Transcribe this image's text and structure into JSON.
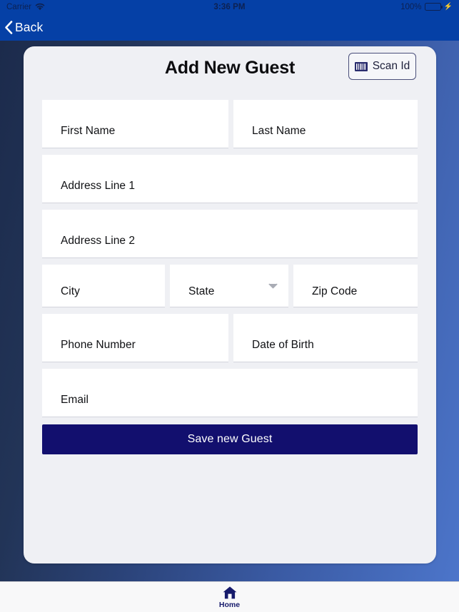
{
  "status_bar": {
    "carrier": "Carrier",
    "wifi_icon": "wifi-icon",
    "time": "3:36 PM",
    "battery_percent": "100%",
    "battery_icon": "battery-full-icon",
    "charging_icon": "lightning-bolt-icon",
    "bg_color": "#0540a6",
    "text_color": "#0d2152",
    "battery_fill_color": "#32e35c"
  },
  "nav_bar": {
    "back_label": "Back",
    "back_icon": "chevron-left-icon",
    "bg_color": "#0540a6",
    "text_color": "#ffffff"
  },
  "background": {
    "gradient_from": "#1c2b4c",
    "gradient_to": "#4c75ca"
  },
  "card": {
    "title": "Add New Guest",
    "bg_color": "#eff0f4",
    "scan_button": {
      "label": "Scan Id",
      "icon": "barcode-icon",
      "border_color": "#4a4f7a",
      "text_color": "#1d1f3a"
    }
  },
  "form": {
    "rows": [
      {
        "fields": [
          {
            "label": "First Name",
            "type": "text",
            "value": "",
            "name": "first-name"
          },
          {
            "label": "Last Name",
            "type": "text",
            "value": "",
            "name": "last-name"
          }
        ]
      },
      {
        "fields": [
          {
            "label": "Address Line 1",
            "type": "text",
            "value": "",
            "name": "address-line-1"
          }
        ]
      },
      {
        "fields": [
          {
            "label": "Address Line 2",
            "type": "text",
            "value": "",
            "name": "address-line-2"
          }
        ]
      },
      {
        "fields": [
          {
            "label": "City",
            "type": "text",
            "value": "",
            "name": "city"
          },
          {
            "label": "State",
            "type": "select",
            "value": "",
            "name": "state",
            "icon": "chevron-down-icon"
          },
          {
            "label": "Zip Code",
            "type": "text",
            "value": "",
            "name": "zip-code"
          }
        ]
      },
      {
        "fields": [
          {
            "label": "Phone Number",
            "type": "tel",
            "value": "",
            "name": "phone-number"
          },
          {
            "label": "Date of Birth",
            "type": "date",
            "value": "",
            "name": "date-of-birth"
          }
        ]
      },
      {
        "fields": [
          {
            "label": "Email",
            "type": "email",
            "value": "",
            "name": "email"
          }
        ]
      }
    ],
    "labels": {
      "first_name": "First Name",
      "last_name": "Last Name",
      "address_line_1": "Address Line 1",
      "address_line_2": "Address Line 2",
      "city": "City",
      "state": "State",
      "zip_code": "Zip Code",
      "phone_number": "Phone Number",
      "date_of_birth": "Date of Birth",
      "email": "Email"
    },
    "save_button": {
      "label": "Save new Guest",
      "bg_color": "#120f6e",
      "text_color": "#ffffff"
    }
  },
  "tab_bar": {
    "items": [
      {
        "label": "Home",
        "icon": "home-icon",
        "active": true
      }
    ],
    "active_color": "#161a6b",
    "bg_color": "#f8f8f9"
  }
}
